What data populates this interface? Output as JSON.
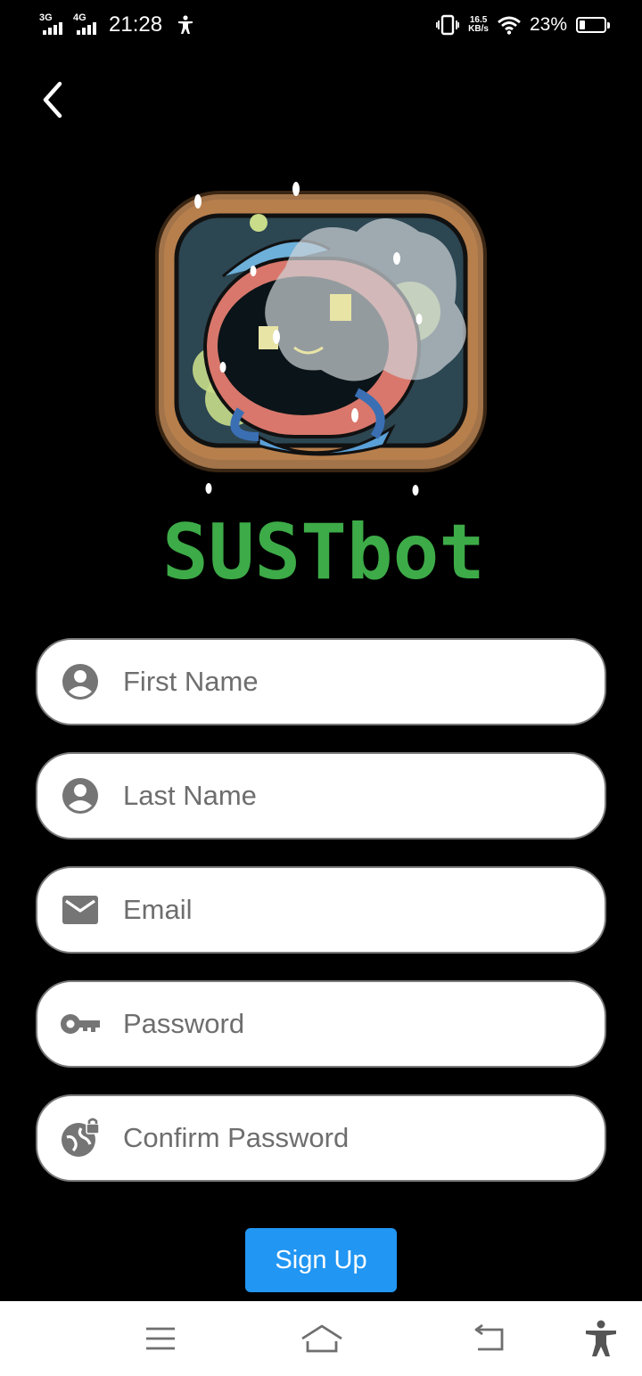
{
  "status_bar": {
    "network_1": "3G",
    "network_2": "4G",
    "time": "21:28",
    "speed_value": "16.5",
    "speed_unit": "KB/s",
    "battery_percent": "23%",
    "battery_level": 0.23,
    "icons": [
      "signal-3g-icon",
      "signal-4g-icon",
      "accessibility-icon",
      "vibrate-icon",
      "wifi-icon",
      "battery-icon"
    ]
  },
  "header": {
    "back_icon": "chevron-left-icon"
  },
  "logo": {
    "wordmark": "SUSTbot",
    "wordmark_color": "#3dab48"
  },
  "form": {
    "first_name": {
      "placeholder": "First Name",
      "value": "",
      "icon": "account-circle-icon"
    },
    "last_name": {
      "placeholder": "Last Name",
      "value": "",
      "icon": "account-circle-icon"
    },
    "email": {
      "placeholder": "Email",
      "value": "",
      "icon": "mail-icon"
    },
    "password": {
      "placeholder": "Password",
      "value": "",
      "icon": "key-icon"
    },
    "confirm_password": {
      "placeholder": "Confirm Password",
      "value": "",
      "icon": "globe-lock-icon"
    }
  },
  "signup": {
    "label": "Sign Up",
    "color": "#2196f3"
  },
  "nav_bar": {
    "icons": [
      "menu-icon",
      "home-icon",
      "back-icon",
      "accessibility-icon"
    ]
  }
}
